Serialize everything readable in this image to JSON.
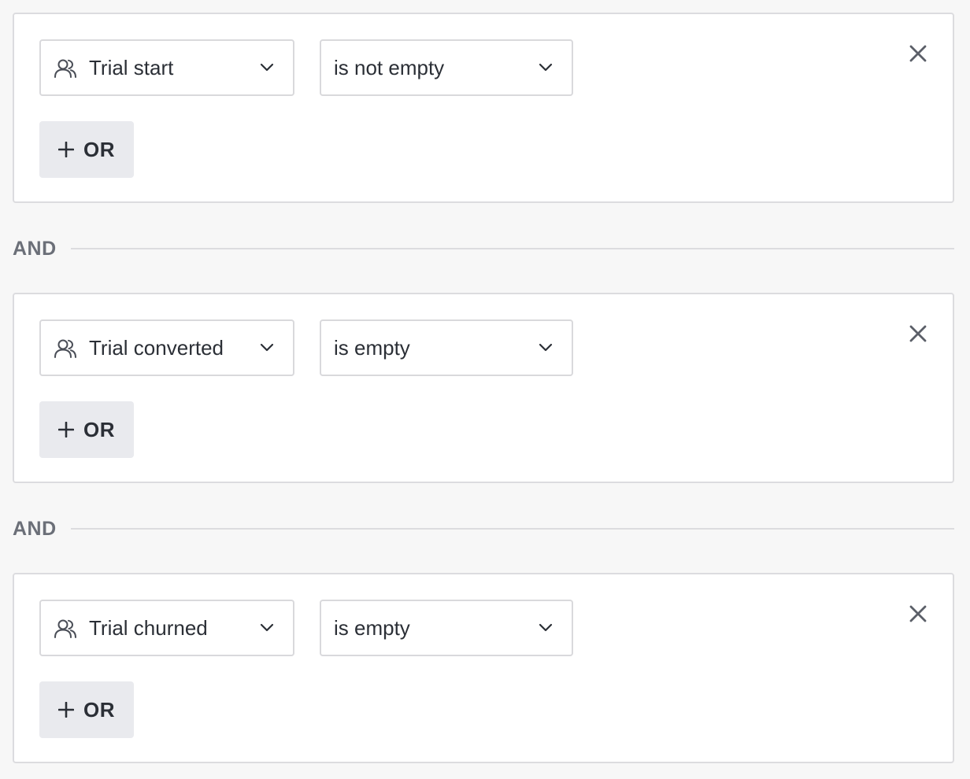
{
  "filters": [
    {
      "property": "Trial start",
      "operator": "is not empty",
      "or_button_label": "OR",
      "property_icon": "users-icon",
      "close_icon": "close-icon"
    },
    {
      "property": "Trial converted",
      "operator": "is empty",
      "or_button_label": "OR",
      "property_icon": "users-icon",
      "close_icon": "close-icon"
    },
    {
      "property": "Trial churned",
      "operator": "is empty",
      "or_button_label": "OR",
      "property_icon": "users-icon",
      "close_icon": "close-icon"
    }
  ],
  "connectors": [
    {
      "label": "AND"
    },
    {
      "label": "AND"
    }
  ],
  "colors": {
    "background": "#f7f7f7",
    "card": "#ffffff",
    "border": "#dcdcdf",
    "text": "#2b2f36",
    "muted_text": "#6b6f78",
    "or_button_bg": "#e9eaee"
  }
}
